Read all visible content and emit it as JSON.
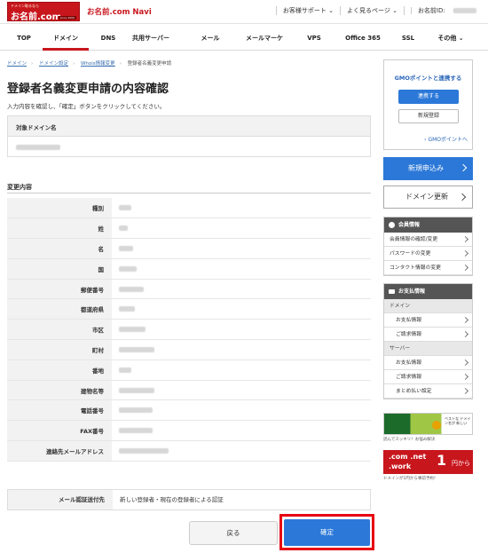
{
  "header": {
    "logo_small": "ドメイン取るなら",
    "logo_text": "お名前.com",
    "logo_badge": "since 2000",
    "app_title": "お名前.com Navi",
    "links": [
      "お客様サポート ⌄",
      "よく見るページ ⌄",
      "お名前ID:"
    ]
  },
  "nav": {
    "items": [
      "TOP",
      "ドメイン",
      "DNS",
      "共用サーバー",
      "メール",
      "メールマーケ",
      "VPS",
      "Office 365",
      "SSL",
      "その他 ⌄"
    ],
    "active": "ドメイン"
  },
  "breadcrumb": {
    "items": [
      "ドメイン",
      "ドメイン設定",
      "Whois情報変更",
      "登録者名義変更申請"
    ]
  },
  "main": {
    "title": "登録者名義変更申請の内容確認",
    "instruction": "入力内容を確認し、「確定」ボタンをクリックしてください。",
    "domain_label": "対象ドメイン名",
    "change_label": "変更内容",
    "fields": [
      "種別",
      "姓",
      "名",
      "国",
      "郵便番号",
      "都道府県",
      "市区",
      "町村",
      "番地",
      "建物名等",
      "電話番号",
      "FAX番号",
      "連絡先メールアドレス"
    ],
    "notify_label": "メール認証送付先",
    "notify_value": "新しい登録者・現在の登録者による認証",
    "back_label": "戻る",
    "confirm_label": "確定"
  },
  "sidebar": {
    "gmo_title": "GMOポイントと連携する",
    "gmo_link_button": "連携する",
    "gmo_register_button": "新規登録",
    "gmo_point_link": "GMOポイントへ",
    "new_application": "新規申込み",
    "domain_renewal": "ドメイン更新",
    "member_title": "会員情報",
    "member_items": [
      "会員情報の確認/変更",
      "パスワードの変更",
      "コンタクト情報の変更"
    ],
    "payment_title": "お支払情報",
    "cat_domain": "ドメイン",
    "domain_items": [
      "お支払情報",
      "ご請求情報"
    ],
    "cat_server": "サーバー",
    "server_items": [
      "お支払情報",
      "ご請求情報",
      "まとめ払い設定"
    ],
    "ad1_text": "ベストな ドメイン名が 新しい",
    "ad1_caption": "読んでスッキリ！お悩み解決",
    "ad2_text_1": ".com .net",
    "ad2_text_2": ".work",
    "ad2_num": "1",
    "ad2_unit": "円から",
    "ad2_caption": "ドメインが1円から事前予約！"
  }
}
